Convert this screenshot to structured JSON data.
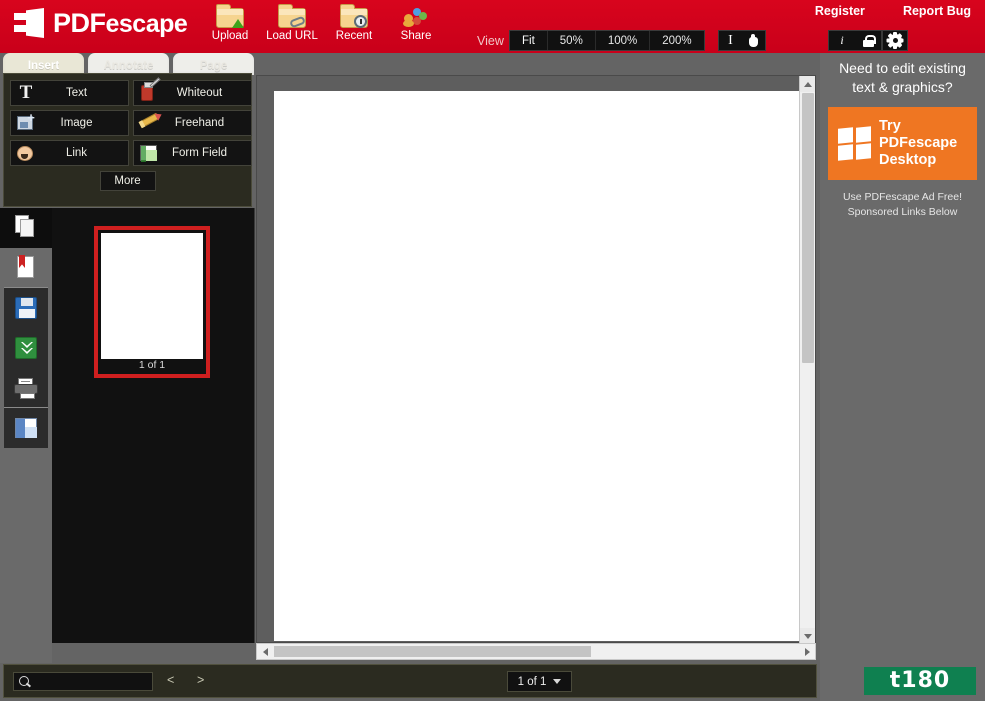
{
  "header": {
    "brand_pdf": "PDF",
    "brand_escape": "escape",
    "brand_logo_icon": "pdfescape-door-logo",
    "actions": [
      {
        "label": "Upload",
        "icon": "folder-upload-icon"
      },
      {
        "label": "Load URL",
        "icon": "folder-link-icon"
      },
      {
        "label": "Recent",
        "icon": "folder-clock-icon"
      },
      {
        "label": "Share",
        "icon": "share-people-icon"
      }
    ],
    "view_label": "View",
    "zoom_options": [
      "Fit",
      "50%",
      "100%",
      "200%"
    ],
    "zoom_active": "Fit",
    "cursor_tools": [
      {
        "icon": "text-cursor-icon",
        "name": "text-select-tool"
      },
      {
        "icon": "hand-icon",
        "name": "pan-hand-tool"
      }
    ],
    "util_icons": [
      {
        "icon": "info-icon",
        "name": "document-info"
      },
      {
        "icon": "lock-icon",
        "name": "document-security"
      }
    ],
    "gear_icon": "gear-icon",
    "links": [
      {
        "label": "Register"
      },
      {
        "label": "Report Bug"
      }
    ],
    "accent_color": "#d0021b"
  },
  "tool_panel": {
    "tabs": [
      {
        "label": "Insert",
        "active": true
      },
      {
        "label": "Annotate",
        "active": false
      },
      {
        "label": "Page",
        "active": false
      }
    ],
    "tools": [
      {
        "label": "Text",
        "icon": "text-tool-icon"
      },
      {
        "label": "Whiteout",
        "icon": "whiteout-tool-icon"
      },
      {
        "label": "Image",
        "icon": "image-tool-icon"
      },
      {
        "label": "Freehand",
        "icon": "freehand-pencil-icon"
      },
      {
        "label": "Link",
        "icon": "link-tool-icon"
      },
      {
        "label": "Form Field",
        "icon": "form-field-icon"
      }
    ],
    "more_label": "More"
  },
  "rail": {
    "items": [
      {
        "name": "pages-panel",
        "icon": "pages-icon",
        "active": true
      },
      {
        "name": "bookmarks-panel",
        "icon": "bookmark-page-icon",
        "active": false
      },
      {
        "name": "save-document",
        "icon": "save-floppy-icon",
        "active": false
      },
      {
        "name": "download-document",
        "icon": "download-green-icon",
        "active": false
      },
      {
        "name": "print-document",
        "icon": "print-icon",
        "active": false
      },
      {
        "name": "window-layout",
        "icon": "window-layout-icon",
        "active": false
      }
    ]
  },
  "thumbnails": {
    "pages": [
      {
        "caption": "1 of 1",
        "selected": true
      }
    ],
    "selection_color": "#cf1f1f"
  },
  "viewer": {
    "vertical_scroll": {
      "up": "scroll-up",
      "down": "scroll-down"
    },
    "horizontal_scroll": {
      "left": "scroll-left",
      "right": "scroll-right"
    }
  },
  "ad": {
    "headline": "Need to edit existing text & graphics?",
    "cta_line1": "Try",
    "cta_line2": "PDFescape",
    "cta_line3": "Desktop",
    "cta_icon": "windows-logo-icon",
    "note_line1": "Use PDFescape Ad Free!",
    "note_line2": "Sponsored Links Below",
    "cta_color": "#ef7622"
  },
  "bottom": {
    "search_value": "",
    "search_placeholder": "",
    "search_icon": "search-icon",
    "prev_label": "<",
    "next_label": ">",
    "page_indicator": "1 of 1"
  },
  "watermark": {
    "text": "t180",
    "color": "#0f8050"
  }
}
